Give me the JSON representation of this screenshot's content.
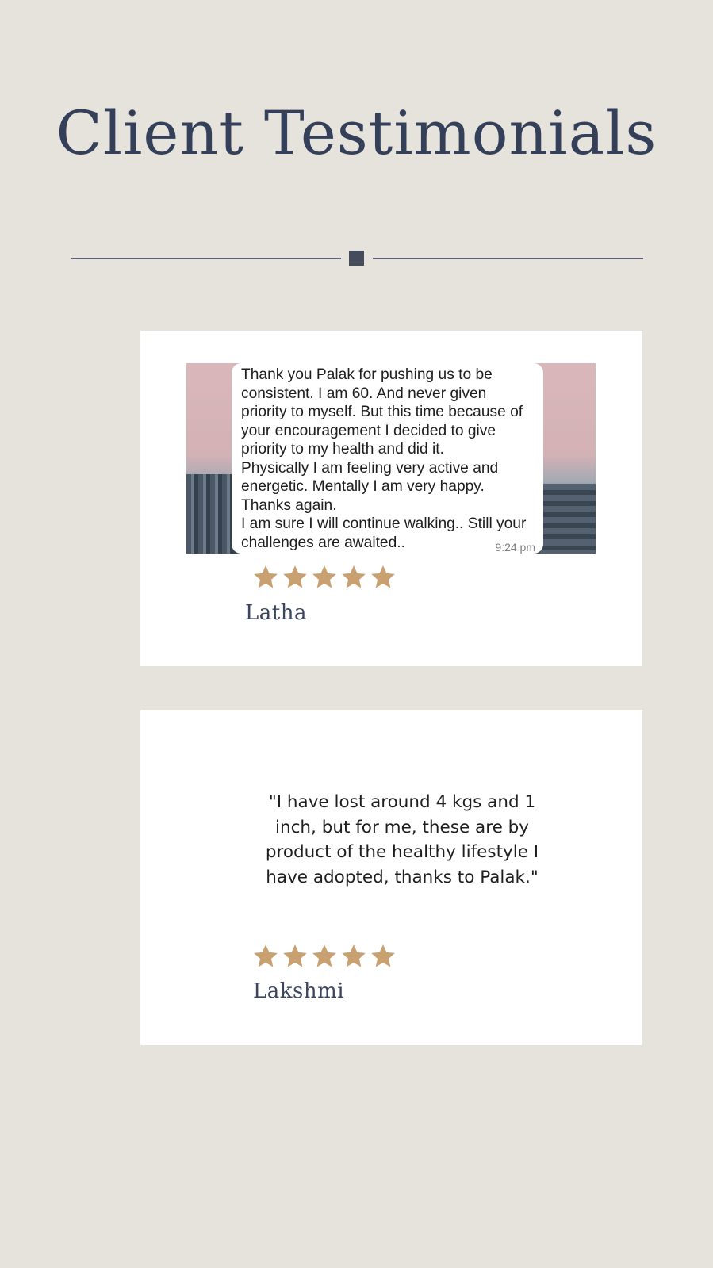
{
  "page": {
    "title": "Client Testimonials",
    "background_color": "#e6e3dd",
    "title_color": "#34405a",
    "star_color": "#c9a06f"
  },
  "testimonials": [
    {
      "type": "chat-screenshot",
      "message": "Thank you Palak for pushing us to be consistent. I am 60. And never given priority to myself. But this time because of your encouragement I decided to give priority to my health and did it.\nPhysically I am feeling very active and energetic. Mentally I am very happy.\nThanks again.\nI am sure I will continue walking.. Still your challenges are awaited..",
      "time": "9:24 pm",
      "rating": 5,
      "name": "Latha"
    },
    {
      "type": "quote",
      "quote": "\"I have lost around 4 kgs and 1 inch, but for me, these are by product of the healthy lifestyle I have adopted, thanks to Palak.\"",
      "rating": 5,
      "name": "Lakshmi"
    }
  ]
}
